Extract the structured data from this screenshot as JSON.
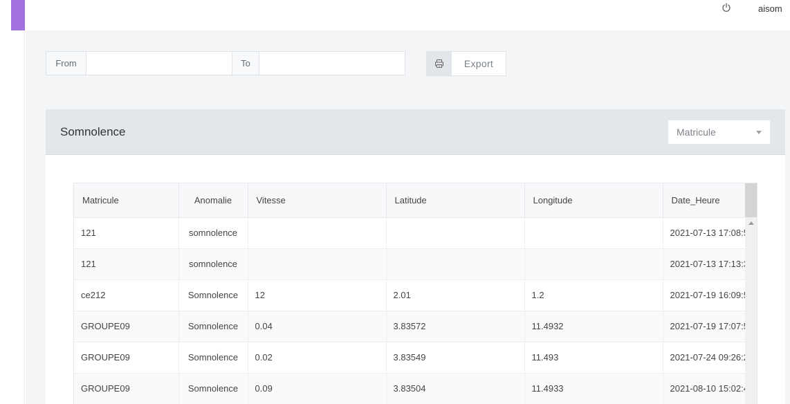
{
  "header": {
    "username": "aisom",
    "power_icon": "power-icon",
    "brand_color": "#a273e0"
  },
  "filters": {
    "from_label": "From",
    "from_value": "",
    "to_label": "To",
    "to_value": "",
    "export_label": "Export",
    "export_icon": "printer-icon"
  },
  "card": {
    "title": "Somnolence",
    "select_value": "Matricule"
  },
  "table": {
    "columns": [
      "Matricule",
      "Anomalie",
      "Vitesse",
      "Latitude",
      "Longitude",
      "Date_Heure"
    ],
    "rows": [
      [
        "121",
        "somnolence",
        "",
        "",
        "",
        "2021-07-13 17:08:5"
      ],
      [
        "121",
        "somnolence",
        "",
        "",
        "",
        "2021-07-13 17:13:3"
      ],
      [
        "ce212",
        "Somnolence",
        "12",
        "2.01",
        "1.2",
        "2021-07-19 16:09:5"
      ],
      [
        "GROUPE09",
        "Somnolence",
        "0.04",
        "3.83572",
        "11.4932",
        "2021-07-19 17:07:5"
      ],
      [
        "GROUPE09",
        "Somnolence",
        "0.02",
        "3.83549",
        "11.493",
        "2021-07-24 09:26:2"
      ],
      [
        "GROUPE09",
        "Somnolence",
        "0.09",
        "3.83504",
        "11.4933",
        "2021-08-10 15:02:4"
      ]
    ]
  }
}
